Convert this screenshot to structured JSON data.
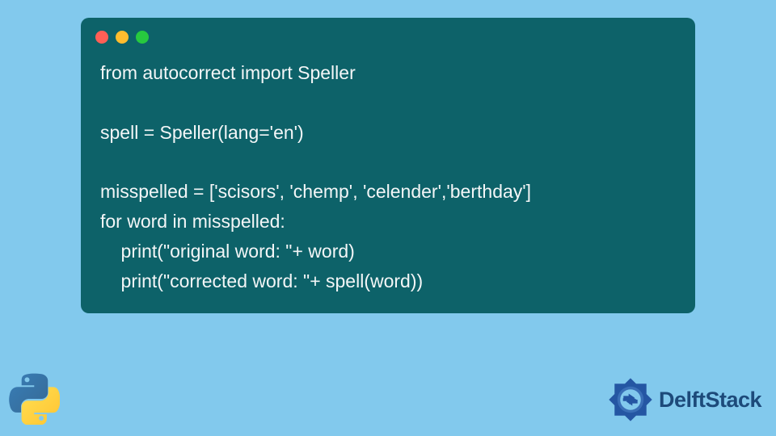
{
  "code": {
    "lines": [
      "from autocorrect import Speller",
      "",
      "spell = Speller(lang='en')",
      "",
      "misspelled = ['scisors', 'chemp', 'celender','berthday']",
      "for word in misspelled:",
      "    print(\"original word: \"+ word)",
      "    print(\"corrected word: \"+ spell(word))"
    ]
  },
  "branding": {
    "name": "DelftStack"
  },
  "colors": {
    "background": "#82c9ed",
    "window": "#0d6269",
    "text": "#f3f6f7",
    "dot_red": "#ff5f56",
    "dot_yellow": "#ffbd2e",
    "dot_green": "#27c93f",
    "brand_text": "#1d4a7a"
  }
}
